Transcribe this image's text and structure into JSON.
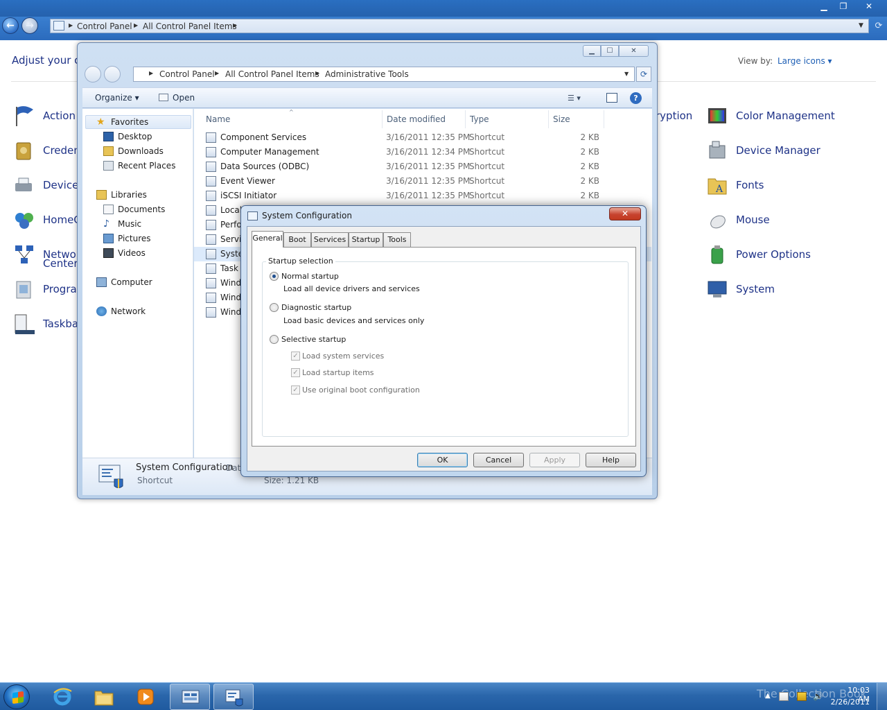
{
  "control_panel": {
    "breadcrumb": [
      "Control Panel",
      "All Control Panel Items"
    ],
    "heading": "Adjust your computer's settings",
    "view_by_label": "View by:",
    "view_by_value": "Large icons ▾",
    "items_left": [
      {
        "label": "Action",
        "icon": "action-center-flag-icon"
      },
      {
        "label": "Creden",
        "icon": "credential-manager-icon"
      },
      {
        "label": "Devices",
        "icon": "devices-printers-icon"
      },
      {
        "label": "HomeG",
        "icon": "homegroup-icon"
      },
      {
        "label": "Networ",
        "label2": "Center",
        "icon": "network-center-icon"
      },
      {
        "label": "Progra",
        "icon": "programs-icon"
      },
      {
        "label": "Taskba",
        "icon": "taskbar-icon"
      }
    ],
    "partial_item": "ryption",
    "items_right": [
      {
        "label": "Color Management",
        "icon": "color-management-icon"
      },
      {
        "label": "Device Manager",
        "icon": "device-manager-icon"
      },
      {
        "label": "Fonts",
        "icon": "fonts-icon"
      },
      {
        "label": "Mouse",
        "icon": "mouse-icon"
      },
      {
        "label": "Power Options",
        "icon": "power-options-icon"
      },
      {
        "label": "System",
        "icon": "system-icon"
      }
    ]
  },
  "explorer": {
    "breadcrumb": [
      "Control Panel",
      "All Control Panel Items",
      "Administrative Tools"
    ],
    "toolbar": {
      "organize": "Organize ▾",
      "open": "Open"
    },
    "nav": {
      "favorites": "Favorites",
      "favorites_items": [
        "Desktop",
        "Downloads",
        "Recent Places"
      ],
      "libraries": "Libraries",
      "libraries_items": [
        "Documents",
        "Music",
        "Pictures",
        "Videos"
      ],
      "computer": "Computer",
      "network": "Network"
    },
    "columns": {
      "name": "Name",
      "date": "Date modified",
      "type": "Type",
      "size": "Size"
    },
    "files": [
      {
        "name": "Component Services",
        "date": "3/16/2011 12:35 PM",
        "type": "Shortcut",
        "size": "2 KB"
      },
      {
        "name": "Computer Management",
        "date": "3/16/2011 12:34 PM",
        "type": "Shortcut",
        "size": "2 KB"
      },
      {
        "name": "Data Sources (ODBC)",
        "date": "3/16/2011 12:35 PM",
        "type": "Shortcut",
        "size": "2 KB"
      },
      {
        "name": "Event Viewer",
        "date": "3/16/2011 12:35 PM",
        "type": "Shortcut",
        "size": "2 KB"
      },
      {
        "name": "iSCSI Initiator",
        "date": "3/16/2011 12:35 PM",
        "type": "Shortcut",
        "size": "2 KB"
      },
      {
        "name": "Local",
        "date": "",
        "type": "",
        "size": ""
      },
      {
        "name": "Perfor",
        "date": "",
        "type": "",
        "size": ""
      },
      {
        "name": "Servic",
        "date": "",
        "type": "",
        "size": ""
      },
      {
        "name": "Systen",
        "date": "",
        "type": "",
        "size": ""
      },
      {
        "name": "Task S",
        "date": "",
        "type": "",
        "size": ""
      },
      {
        "name": "Windo",
        "date": "",
        "type": "",
        "size": ""
      },
      {
        "name": "Windo",
        "date": "",
        "type": "",
        "size": ""
      },
      {
        "name": "Windo",
        "date": "",
        "type": "",
        "size": ""
      }
    ],
    "details": {
      "name": "System Configuration",
      "date_label": "Date",
      "type": "Shortcut",
      "size": "Size: 1.21 KB"
    }
  },
  "dialog": {
    "title": "System Configuration",
    "tabs": [
      "General",
      "Boot",
      "Services",
      "Startup",
      "Tools"
    ],
    "group_label": "Startup selection",
    "options": [
      {
        "label": "Normal startup",
        "desc": "Load all device drivers and services",
        "selected": true
      },
      {
        "label": "Diagnostic startup",
        "desc": "Load basic devices and services only",
        "selected": false
      },
      {
        "label": "Selective startup",
        "desc": "",
        "selected": false
      }
    ],
    "checks": [
      {
        "label": "Load system services",
        "checked": true
      },
      {
        "label": "Load startup items",
        "checked": true
      },
      {
        "label": "Use original boot configuration",
        "checked": true
      }
    ],
    "buttons": {
      "ok": "OK",
      "cancel": "Cancel",
      "apply": "Apply",
      "help": "Help"
    }
  },
  "taskbar": {
    "watermark": "The Collection Book",
    "time": "10:03 AM",
    "date": "2/26/2011"
  }
}
